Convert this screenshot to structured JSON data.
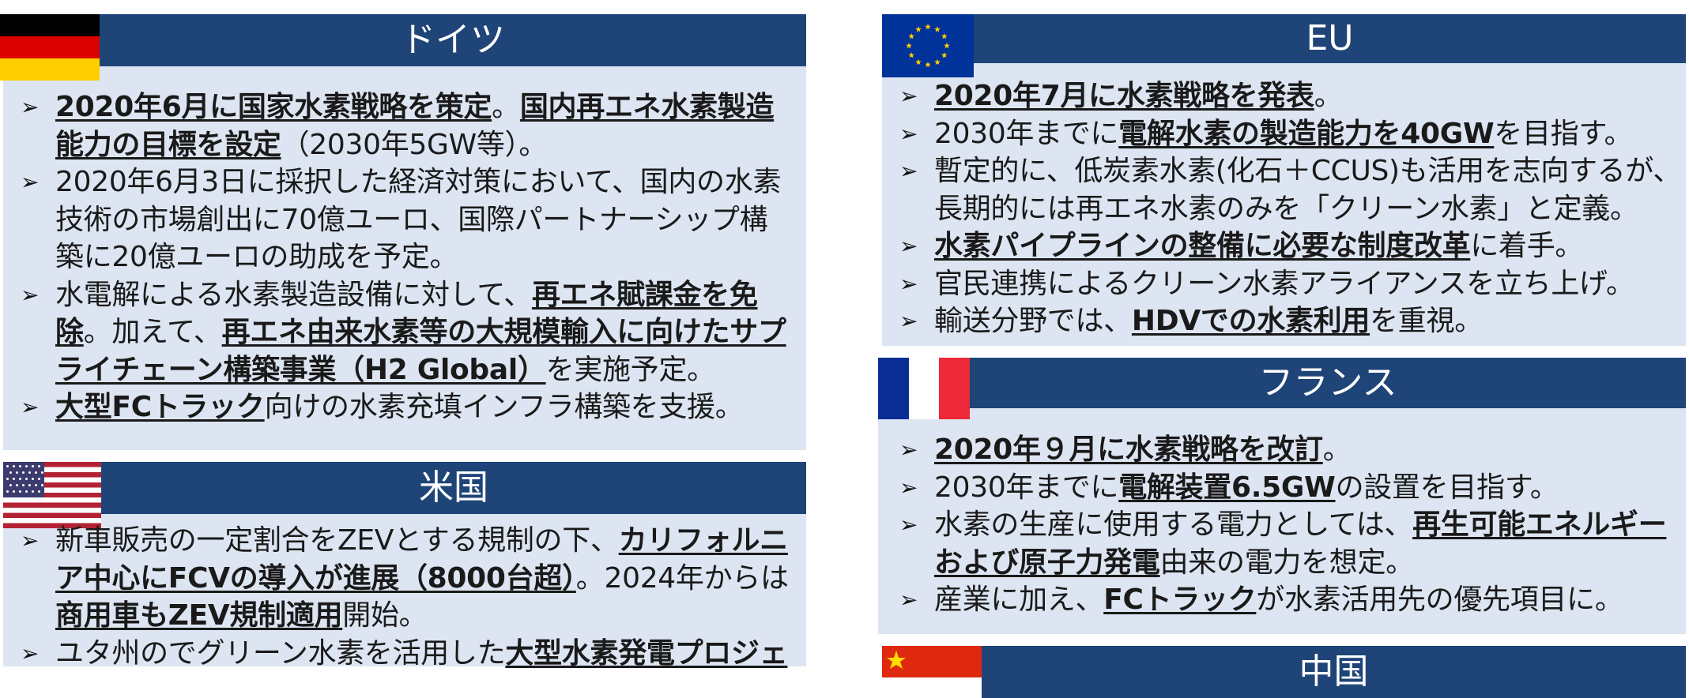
{
  "colors": {
    "header_bg": "#1f4478",
    "panel_bg": "#dde5f2"
  },
  "germany": {
    "title": "ドイツ",
    "flag_icon": "germany-flag-icon",
    "bullets": [
      [
        {
          "t": "2020年6月に国家水素戦略を策定",
          "b": true
        },
        {
          "t": "。",
          "b": false
        },
        {
          "t": "国内再エネ水素製造能力の目標を設定",
          "b": true
        },
        {
          "t": "（2030年5GW等）。",
          "b": false
        }
      ],
      [
        {
          "t": "2020年6月3日に採択した経済対策において、国内の水素技術の市場創出に70億ユーロ、国際パートナーシップ構築に20億ユーロの助成を予定。",
          "b": false
        }
      ],
      [
        {
          "t": "水電解による水素製造設備に対して、",
          "b": false
        },
        {
          "t": "再エネ賦課金を免除",
          "b": true
        },
        {
          "t": "。加えて、",
          "b": false
        },
        {
          "t": "再エネ由来水素等の大規模輸入に向けたサプライチェーン構築事業（H2 Global）",
          "b": true
        },
        {
          "t": "を実施予定。",
          "b": false
        }
      ],
      [
        {
          "t": "大型FCトラック",
          "b": true
        },
        {
          "t": "向けの水素充填インフラ構築を支援。",
          "b": false
        }
      ]
    ]
  },
  "usa": {
    "title": "米国",
    "flag_icon": "usa-flag-icon",
    "bullets": [
      [
        {
          "t": "新車販売の一定割合をZEVとする規制の下、",
          "b": false
        },
        {
          "t": "カリフォルニア中心にFCVの導入が進展（8000台超）",
          "b": true
        },
        {
          "t": "。2024年からは",
          "b": false
        },
        {
          "t": "商用車もZEV規制適用",
          "b": true
        },
        {
          "t": "開始。",
          "b": false
        }
      ],
      [
        {
          "t": "ユタ州のでグリーン水素を活用した",
          "b": false
        },
        {
          "t": "大型水素発電プロジェ",
          "b": true
        }
      ]
    ]
  },
  "eu": {
    "title": "EU",
    "flag_icon": "eu-flag-icon",
    "bullets": [
      [
        {
          "t": "2020年7月に水素戦略を発表",
          "b": true
        },
        {
          "t": "。",
          "b": false
        }
      ],
      [
        {
          "t": "2030年までに",
          "b": false
        },
        {
          "t": "電解水素の製造能力を40GW",
          "b": true
        },
        {
          "t": "を目指す。",
          "b": false
        }
      ],
      [
        {
          "t": "暫定的に、低炭素水素(化石＋CCUS)も活用を志向するが、長期的には再エネ水素のみを「クリーン水素」と定義。",
          "b": false
        }
      ],
      [
        {
          "t": "水素パイプラインの整備に必要な制度改革",
          "b": true
        },
        {
          "t": "に着手。",
          "b": false
        }
      ],
      [
        {
          "t": "官民連携によるクリーン水素アライアンスを立ち上げ。",
          "b": false
        }
      ],
      [
        {
          "t": "輸送分野では、",
          "b": false
        },
        {
          "t": "HDVでの水素利用",
          "b": true
        },
        {
          "t": "を重視。",
          "b": false
        }
      ]
    ]
  },
  "france": {
    "title": "フランス",
    "flag_icon": "france-flag-icon",
    "bullets": [
      [
        {
          "t": "2020年９月に水素戦略を改訂",
          "b": true
        },
        {
          "t": "。",
          "b": false
        }
      ],
      [
        {
          "t": "2030年までに",
          "b": false
        },
        {
          "t": "電解装置6.5GW",
          "b": true
        },
        {
          "t": "の設置を目指す。",
          "b": false
        }
      ],
      [
        {
          "t": "水素の生産に使用する電力としては、",
          "b": false
        },
        {
          "t": "再生可能エネルギーおよび原子力発電",
          "b": true
        },
        {
          "t": "由来の電力を想定。",
          "b": false
        }
      ],
      [
        {
          "t": "産業に加え、",
          "b": false
        },
        {
          "t": "FCトラック",
          "b": true
        },
        {
          "t": "が水素活用先の優先項目に。",
          "b": false
        }
      ]
    ]
  },
  "china": {
    "title": "中国",
    "flag_icon": "china-flag-icon"
  },
  "bullet_icon": "arrowhead-bullet-icon",
  "bullet_glyph": "➢"
}
